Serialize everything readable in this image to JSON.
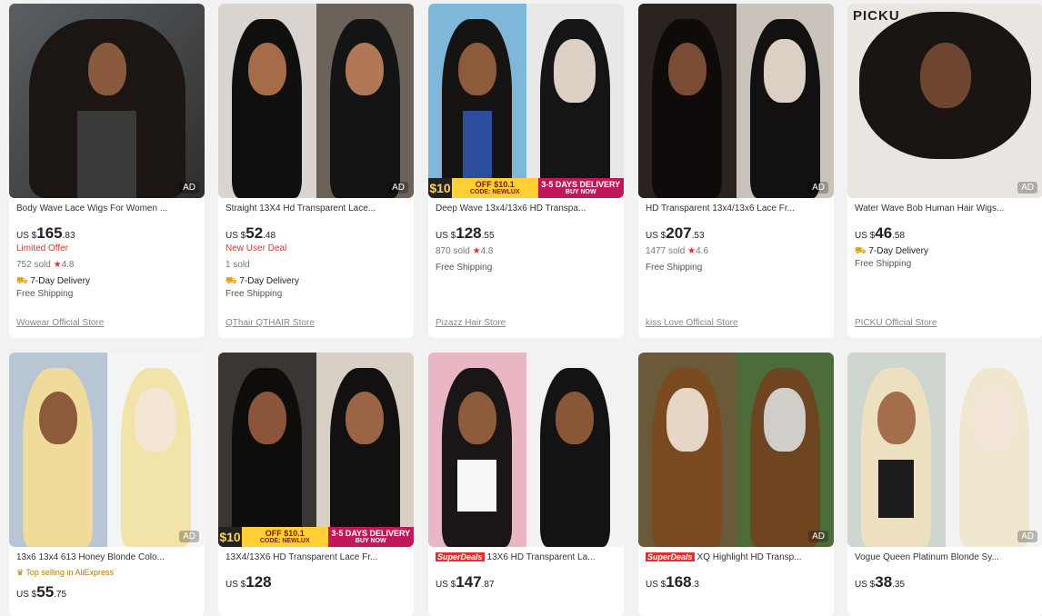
{
  "products": [
    {
      "title": "Body Wave Lace Wigs For Women ...",
      "currency": "US $",
      "price_whole": "165",
      "price_cents": ".83",
      "offer": "Limited Offer",
      "sold": "752 sold",
      "rating": "4.8",
      "delivery": "7-Day Delivery",
      "shipping": "Free Shipping",
      "store": "Wowear Official Store",
      "ad": "AD",
      "logo": "",
      "promo": false
    },
    {
      "title": "Straight 13X4 Hd Transparent Lace...",
      "currency": "US $",
      "price_whole": "52",
      "price_cents": ".48",
      "offer": "New User Deal",
      "sold": "1 sold",
      "rating": "",
      "delivery": "7-Day Delivery",
      "shipping": "Free Shipping",
      "store": "QThair QTHAIR Store",
      "ad": "AD",
      "logo": "",
      "promo": false
    },
    {
      "title": "Deep Wave 13x4/13x6 HD Transpa...",
      "currency": "US $",
      "price_whole": "128",
      "price_cents": ".55",
      "offer": "",
      "sold": "870 sold",
      "rating": "4.8",
      "delivery": "",
      "shipping": "Free Shipping",
      "store": "Pizazz Hair Store",
      "ad": "",
      "logo": "",
      "promo": true
    },
    {
      "title": "HD Transparent 13x4/13x6 Lace Fr...",
      "currency": "US $",
      "price_whole": "207",
      "price_cents": ".53",
      "offer": "",
      "sold": "1477 sold",
      "rating": "4.6",
      "delivery": "",
      "shipping": "Free Shipping",
      "store": "kiss Love Official Store",
      "ad": "AD",
      "logo": "",
      "promo": false
    },
    {
      "title": "Water Wave Bob Human Hair Wigs...",
      "currency": "US $",
      "price_whole": "46",
      "price_cents": ".58",
      "offer": "",
      "sold": "",
      "rating": "",
      "delivery": "7-Day Delivery",
      "shipping": "Free Shipping",
      "store": "PICKU Official Store",
      "ad": "AD",
      "logo": "PICKU",
      "promo": false
    },
    {
      "title": "13x6 13x4 613 Honey Blonde Colo...",
      "currency": "US $",
      "price_whole": "55",
      "price_cents": ".75",
      "tag": "Top selling in AliExpress",
      "ad": "AD",
      "badge": "",
      "promo": false
    },
    {
      "title": "13X4/13X6 HD Transparent Lace Fr...",
      "currency": "US $",
      "price_whole": "128",
      "price_cents": "",
      "tag": "",
      "ad": "",
      "badge": "",
      "promo": true
    },
    {
      "title": "13X6 HD Transparent La...",
      "currency": "US $",
      "price_whole": "147",
      "price_cents": ".87",
      "tag": "",
      "ad": "",
      "badge": "SuperDeals",
      "promo": false
    },
    {
      "title": "XQ Highlight HD Transp...",
      "currency": "US $",
      "price_whole": "168",
      "price_cents": ".3",
      "tag": "",
      "ad": "AD",
      "badge": "SuperDeals",
      "promo": false
    },
    {
      "title": "Vogue Queen Platinum Blonde Sy...",
      "currency": "US $",
      "price_whole": "38",
      "price_cents": ".35",
      "tag": "",
      "ad": "AD",
      "badge": "",
      "promo": false
    }
  ],
  "promo": {
    "ten": "$10",
    "off_line1": "OFF $10.1",
    "off_line2": "CODE: NEWLUX",
    "del_line1": "3-5 DAYS DELIVERY",
    "del_line2": "BUY NOW"
  },
  "colors": {
    "price_red": "#e02f2f",
    "background": "#f2f2f2",
    "card": "#ffffff"
  },
  "icons": {
    "star": "star-icon",
    "truck": "delivery-truck-icon",
    "crown": "crown-icon"
  }
}
